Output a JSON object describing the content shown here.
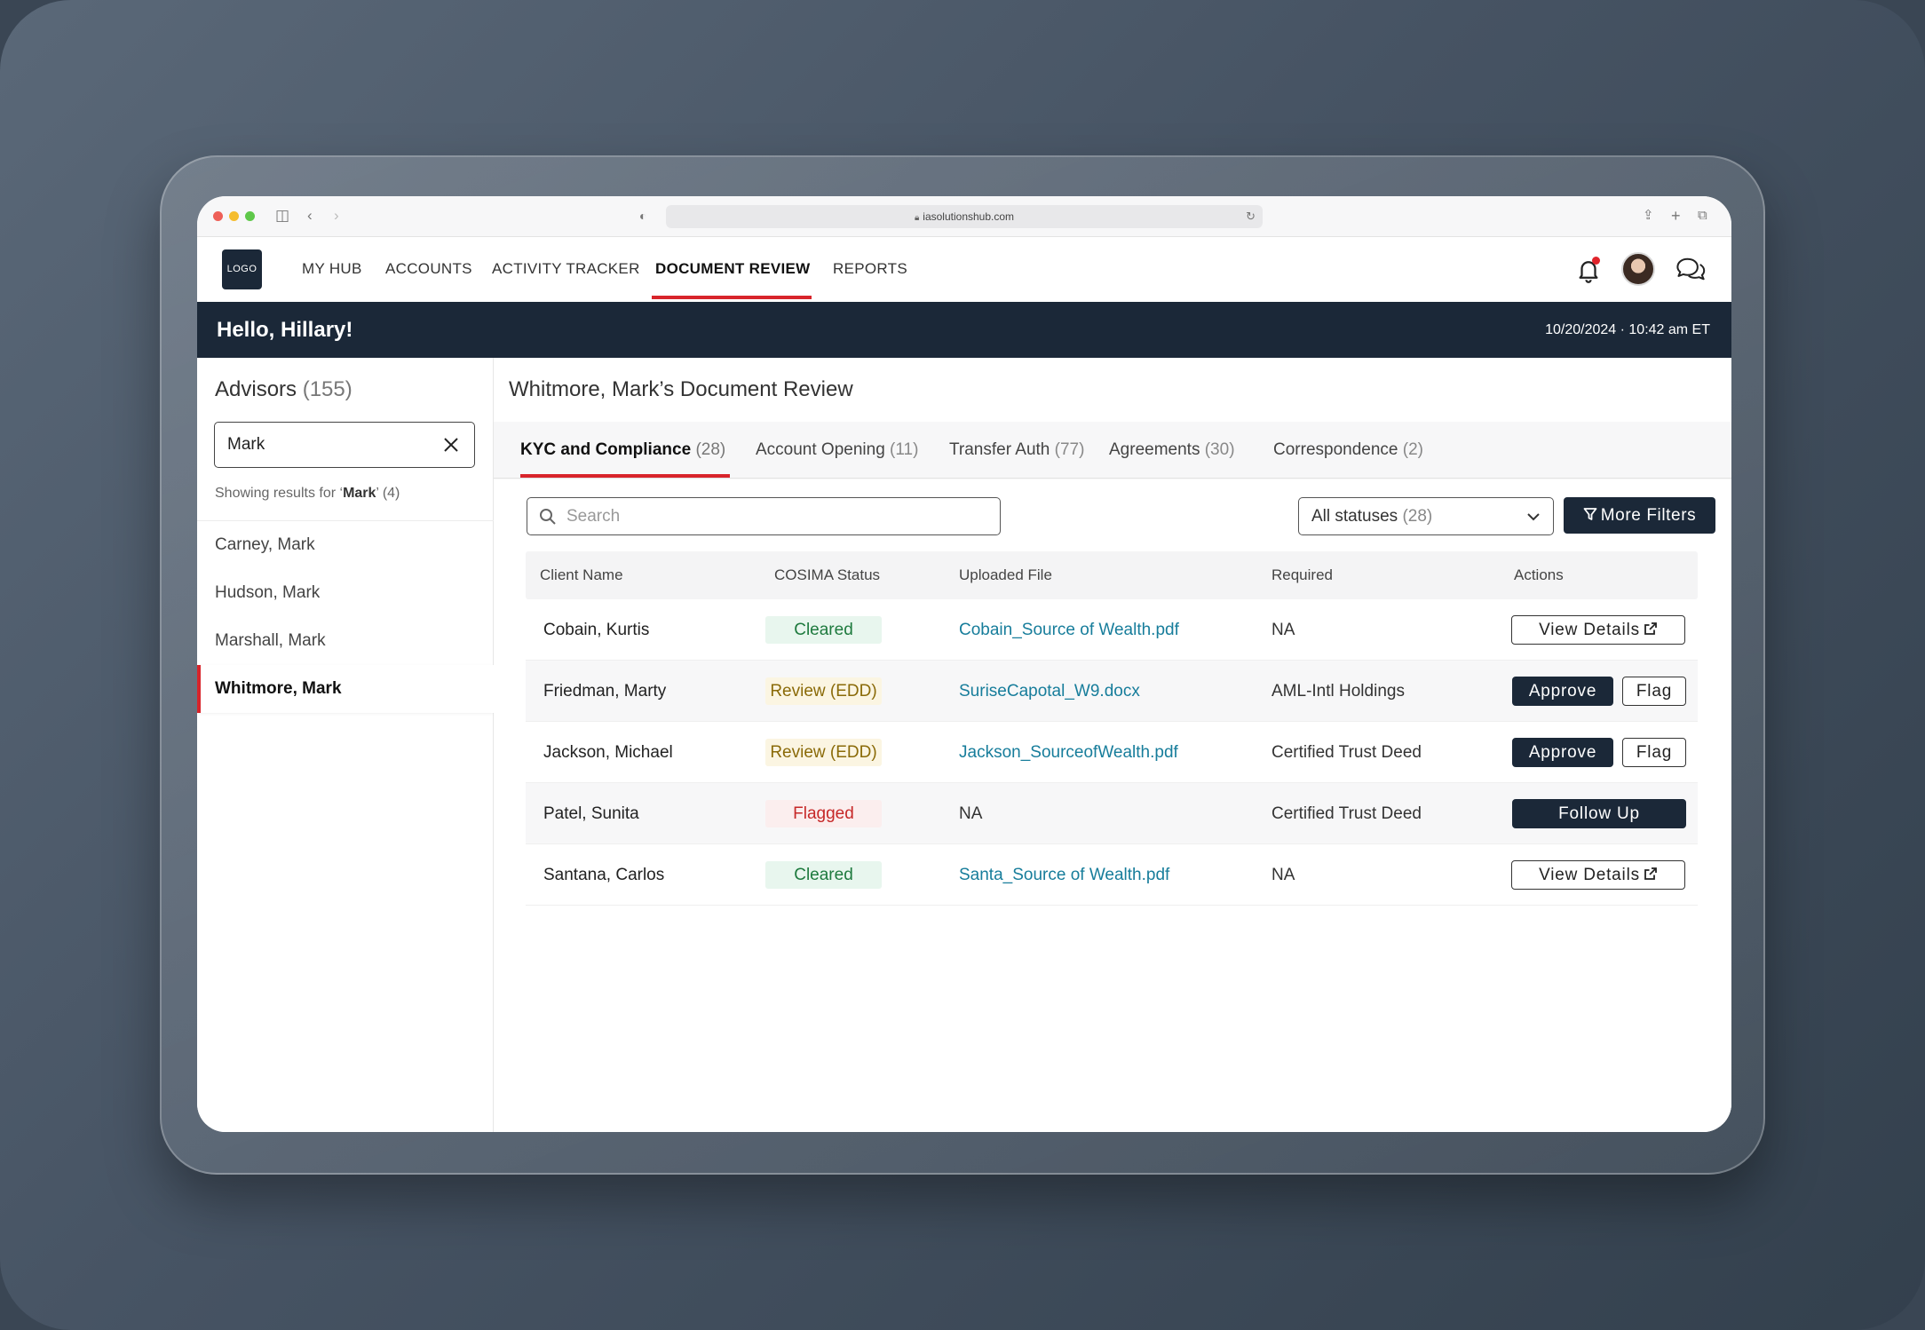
{
  "browser": {
    "url": "iasolutionshub.com"
  },
  "nav": {
    "logo": "LOGO",
    "items": [
      "MY HUB",
      "ACCOUNTS",
      "ACTIVITY TRACKER",
      "DOCUMENT REVIEW",
      "REPORTS"
    ],
    "active": "DOCUMENT REVIEW"
  },
  "greeting": {
    "text": "Hello, Hillary!",
    "datetime": "10/20/2024  ·  10:42 am ET"
  },
  "sidebar": {
    "title": "Advisors",
    "count": "(155)",
    "search_value": "Mark",
    "showing_prefix": "Showing results for ‘",
    "showing_term": "Mark",
    "showing_suffix": "’ (4)",
    "advisors": [
      "Carney, Mark",
      "Hudson, Mark",
      "Marshall, Mark",
      "Whitmore, Mark"
    ],
    "selected": "Whitmore, Mark"
  },
  "main": {
    "title": "Whitmore, Mark’s Document Review",
    "tabs": [
      {
        "label": "KYC and Compliance",
        "count": "(28)"
      },
      {
        "label": "Account Opening",
        "count": "(11)"
      },
      {
        "label": "Transfer Auth",
        "count": "(77)"
      },
      {
        "label": "Agreements",
        "count": "(30)"
      },
      {
        "label": "Correspondence",
        "count": "(2)"
      }
    ],
    "search_placeholder": "Search",
    "status_filter": {
      "label": "All statuses",
      "count": "(28)"
    },
    "more_filters": "More Filters",
    "columns": [
      "Client Name",
      "COSIMA Status",
      "Uploaded File",
      "Required",
      "Actions"
    ],
    "rows": [
      {
        "client": "Cobain, Kurtis",
        "status": "Cleared",
        "file": "Cobain_Source of Wealth.pdf",
        "required": "NA",
        "actions": [
          "View Details"
        ]
      },
      {
        "client": "Friedman, Marty",
        "status": "Review (EDD)",
        "file": "SuriseCapotal_W9.docx",
        "required": "AML-Intl Holdings",
        "actions": [
          "Approve",
          "Flag"
        ]
      },
      {
        "client": "Jackson, Michael",
        "status": "Review (EDD)",
        "file": "Jackson_SourceofWealth.pdf",
        "required": "Certified Trust Deed",
        "actions": [
          "Approve",
          "Flag"
        ]
      },
      {
        "client": "Patel, Sunita",
        "status": "Flagged",
        "file": "NA",
        "required": "Certified Trust Deed",
        "actions": [
          "Follow Up"
        ]
      },
      {
        "client": "Santana, Carlos",
        "status": "Cleared",
        "file": "Santa_Source of Wealth.pdf",
        "required": "NA",
        "actions": [
          "View Details"
        ]
      }
    ]
  },
  "colors": {
    "navy": "#1b2838",
    "accent_red": "#d8242b",
    "link_teal": "#177d9b",
    "cleared": "#1e7a3e",
    "review": "#8a6a08",
    "flagged": "#c62828"
  }
}
